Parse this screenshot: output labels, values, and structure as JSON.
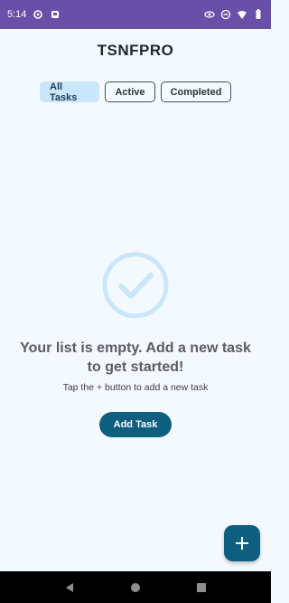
{
  "status_bar": {
    "time": "5:14",
    "background": "#6a4fa8",
    "left_icons": [
      "settings-icon",
      "notification-app-icon"
    ],
    "right_icons": [
      "eye-icon",
      "do-not-disturb-icon",
      "wifi-icon",
      "battery-icon"
    ]
  },
  "app": {
    "title": "TSNFPRO",
    "background": "#f4f9fe",
    "accent": "#0e5e80"
  },
  "tabs": [
    {
      "label": "All Tasks",
      "selected": true
    },
    {
      "label": "Active",
      "selected": false
    },
    {
      "label": "Completed",
      "selected": false
    }
  ],
  "empty_state": {
    "icon": "check-circle-icon",
    "title": "Your list is empty. Add a new task to get started!",
    "subtitle": "Tap the + button to add a new task",
    "button_label": "Add Task"
  },
  "fab": {
    "icon": "plus-icon"
  },
  "nav_bar": {
    "buttons": [
      "back-icon",
      "home-icon",
      "recents-icon"
    ]
  }
}
